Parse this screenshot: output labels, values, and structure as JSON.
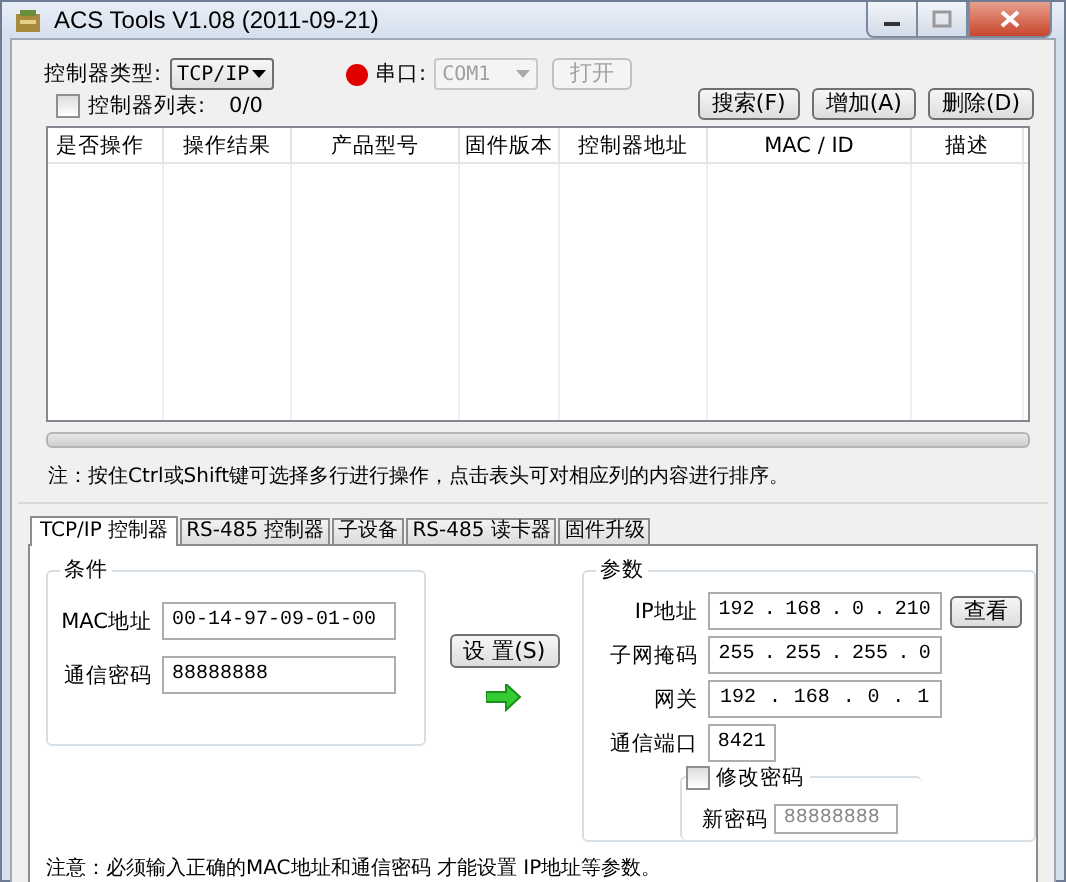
{
  "window": {
    "title": "ACS Tools V1.08 (2011-09-21)"
  },
  "toolbar": {
    "controller_type_label": "控制器类型:",
    "controller_type": "TCP/IP",
    "port_open": false,
    "port_label": "串口:",
    "port": "COM1",
    "port_disabled": true,
    "open_button": {
      "label": "打开",
      "disabled": true
    },
    "controller_list": {
      "label": "控制器列表:",
      "checked": false
    },
    "count": "0/0",
    "buttons": [
      "搜索(F)",
      "增加(A)",
      "删除(D)"
    ]
  },
  "table": {
    "columns": [
      "是否操作",
      "操作结果",
      "产品型号",
      "固件版本",
      "控制器地址",
      "MAC / ID",
      "描述"
    ]
  },
  "hint": "注：按住Ctrl或Shift键可选择多行进行操作，点击表头可对相应列的内容进行排序。",
  "tabs": [
    {
      "label": "TCP/IP 控制器",
      "selected": true
    },
    {
      "label": "RS-485 控制器",
      "selected": false
    },
    {
      "label": "子设备",
      "selected": false
    },
    {
      "label": "RS-485 读卡器",
      "selected": false
    },
    {
      "label": "固件升级",
      "selected": false
    }
  ],
  "conditions": {
    "title": "条件",
    "fields": [
      {
        "label": "MAC地址",
        "value": "00-14-97-09-01-00"
      },
      {
        "label": "通信密码",
        "value": "88888888"
      }
    ]
  },
  "set_button": "设 置(S)",
  "parameters": {
    "title": "参数",
    "addresses": [
      {
        "label": "IP地址",
        "octets": [
          "192",
          "168",
          "0",
          "210"
        ]
      },
      {
        "label": "子网掩码",
        "octets": [
          "255",
          "255",
          "255",
          "0"
        ]
      },
      {
        "label": "网关",
        "octets": [
          "192",
          "168",
          "0",
          "1"
        ]
      }
    ],
    "octet_separator": ".",
    "view_button": "查看",
    "port": {
      "label": "通信端口",
      "value": "8421"
    },
    "change_password": {
      "label": "修改密码",
      "checked": false,
      "new_password_label": "新密码",
      "new_password": "88888888"
    }
  },
  "footer_note": "注意：必须输入正确的MAC地址和通信密码 才能设置 IP地址等参数。"
}
